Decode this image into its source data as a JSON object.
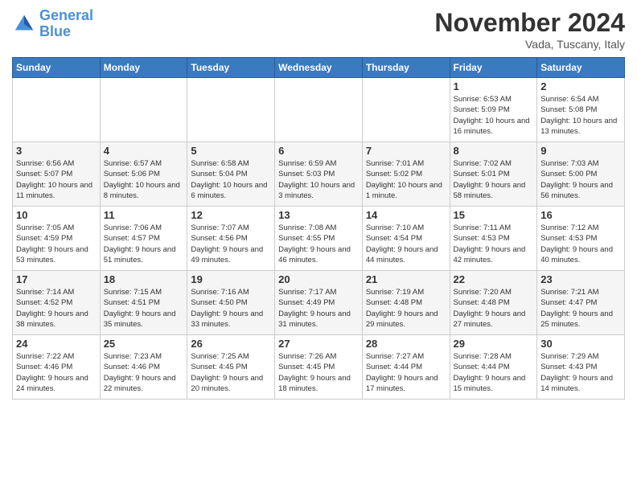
{
  "logo": {
    "line1": "General",
    "line2": "Blue"
  },
  "title": "November 2024",
  "location": "Vada, Tuscany, Italy",
  "headers": [
    "Sunday",
    "Monday",
    "Tuesday",
    "Wednesday",
    "Thursday",
    "Friday",
    "Saturday"
  ],
  "weeks": [
    [
      {
        "day": "",
        "info": ""
      },
      {
        "day": "",
        "info": ""
      },
      {
        "day": "",
        "info": ""
      },
      {
        "day": "",
        "info": ""
      },
      {
        "day": "",
        "info": ""
      },
      {
        "day": "1",
        "info": "Sunrise: 6:53 AM\nSunset: 5:09 PM\nDaylight: 10 hours\nand 16 minutes."
      },
      {
        "day": "2",
        "info": "Sunrise: 6:54 AM\nSunset: 5:08 PM\nDaylight: 10 hours\nand 13 minutes."
      }
    ],
    [
      {
        "day": "3",
        "info": "Sunrise: 6:56 AM\nSunset: 5:07 PM\nDaylight: 10 hours\nand 11 minutes."
      },
      {
        "day": "4",
        "info": "Sunrise: 6:57 AM\nSunset: 5:06 PM\nDaylight: 10 hours\nand 8 minutes."
      },
      {
        "day": "5",
        "info": "Sunrise: 6:58 AM\nSunset: 5:04 PM\nDaylight: 10 hours\nand 6 minutes."
      },
      {
        "day": "6",
        "info": "Sunrise: 6:59 AM\nSunset: 5:03 PM\nDaylight: 10 hours\nand 3 minutes."
      },
      {
        "day": "7",
        "info": "Sunrise: 7:01 AM\nSunset: 5:02 PM\nDaylight: 10 hours\nand 1 minute."
      },
      {
        "day": "8",
        "info": "Sunrise: 7:02 AM\nSunset: 5:01 PM\nDaylight: 9 hours\nand 58 minutes."
      },
      {
        "day": "9",
        "info": "Sunrise: 7:03 AM\nSunset: 5:00 PM\nDaylight: 9 hours\nand 56 minutes."
      }
    ],
    [
      {
        "day": "10",
        "info": "Sunrise: 7:05 AM\nSunset: 4:59 PM\nDaylight: 9 hours\nand 53 minutes."
      },
      {
        "day": "11",
        "info": "Sunrise: 7:06 AM\nSunset: 4:57 PM\nDaylight: 9 hours\nand 51 minutes."
      },
      {
        "day": "12",
        "info": "Sunrise: 7:07 AM\nSunset: 4:56 PM\nDaylight: 9 hours\nand 49 minutes."
      },
      {
        "day": "13",
        "info": "Sunrise: 7:08 AM\nSunset: 4:55 PM\nDaylight: 9 hours\nand 46 minutes."
      },
      {
        "day": "14",
        "info": "Sunrise: 7:10 AM\nSunset: 4:54 PM\nDaylight: 9 hours\nand 44 minutes."
      },
      {
        "day": "15",
        "info": "Sunrise: 7:11 AM\nSunset: 4:53 PM\nDaylight: 9 hours\nand 42 minutes."
      },
      {
        "day": "16",
        "info": "Sunrise: 7:12 AM\nSunset: 4:53 PM\nDaylight: 9 hours\nand 40 minutes."
      }
    ],
    [
      {
        "day": "17",
        "info": "Sunrise: 7:14 AM\nSunset: 4:52 PM\nDaylight: 9 hours\nand 38 minutes."
      },
      {
        "day": "18",
        "info": "Sunrise: 7:15 AM\nSunset: 4:51 PM\nDaylight: 9 hours\nand 35 minutes."
      },
      {
        "day": "19",
        "info": "Sunrise: 7:16 AM\nSunset: 4:50 PM\nDaylight: 9 hours\nand 33 minutes."
      },
      {
        "day": "20",
        "info": "Sunrise: 7:17 AM\nSunset: 4:49 PM\nDaylight: 9 hours\nand 31 minutes."
      },
      {
        "day": "21",
        "info": "Sunrise: 7:19 AM\nSunset: 4:48 PM\nDaylight: 9 hours\nand 29 minutes."
      },
      {
        "day": "22",
        "info": "Sunrise: 7:20 AM\nSunset: 4:48 PM\nDaylight: 9 hours\nand 27 minutes."
      },
      {
        "day": "23",
        "info": "Sunrise: 7:21 AM\nSunset: 4:47 PM\nDaylight: 9 hours\nand 25 minutes."
      }
    ],
    [
      {
        "day": "24",
        "info": "Sunrise: 7:22 AM\nSunset: 4:46 PM\nDaylight: 9 hours\nand 24 minutes."
      },
      {
        "day": "25",
        "info": "Sunrise: 7:23 AM\nSunset: 4:46 PM\nDaylight: 9 hours\nand 22 minutes."
      },
      {
        "day": "26",
        "info": "Sunrise: 7:25 AM\nSunset: 4:45 PM\nDaylight: 9 hours\nand 20 minutes."
      },
      {
        "day": "27",
        "info": "Sunrise: 7:26 AM\nSunset: 4:45 PM\nDaylight: 9 hours\nand 18 minutes."
      },
      {
        "day": "28",
        "info": "Sunrise: 7:27 AM\nSunset: 4:44 PM\nDaylight: 9 hours\nand 17 minutes."
      },
      {
        "day": "29",
        "info": "Sunrise: 7:28 AM\nSunset: 4:44 PM\nDaylight: 9 hours\nand 15 minutes."
      },
      {
        "day": "30",
        "info": "Sunrise: 7:29 AM\nSunset: 4:43 PM\nDaylight: 9 hours\nand 14 minutes."
      }
    ]
  ]
}
